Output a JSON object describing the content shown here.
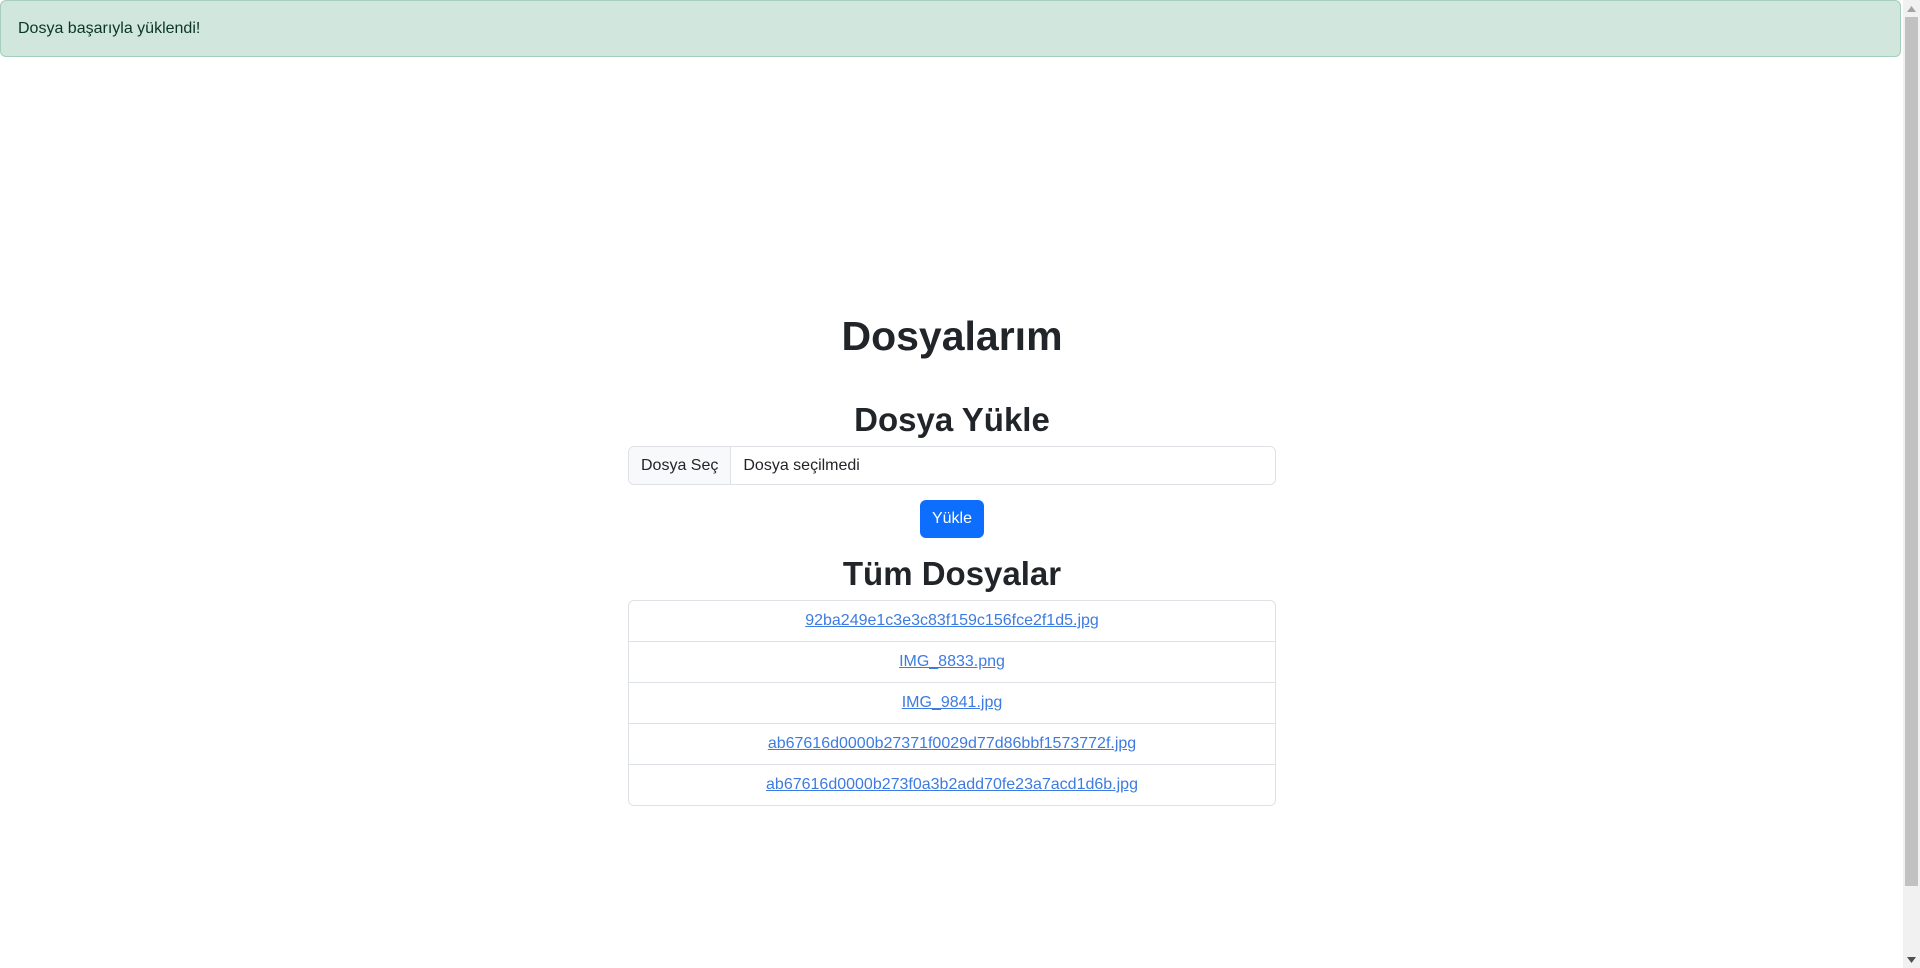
{
  "alert": {
    "message": "Dosya başarıyla yüklendi!"
  },
  "page": {
    "title": "Dosyalarım"
  },
  "upload": {
    "heading": "Dosya Yükle",
    "choose_label": "Dosya Seç",
    "status": "Dosya seçilmedi",
    "submit_label": "Yükle"
  },
  "files": {
    "heading": "Tüm Dosyalar",
    "items": [
      {
        "name": "92ba249e1c3e3c83f159c156fce2f1d5.jpg"
      },
      {
        "name": "IMG_8833.png"
      },
      {
        "name": "IMG_9841.jpg"
      },
      {
        "name": "ab67616d0000b27371f0029d77d86bbf1573772f.jpg"
      },
      {
        "name": "ab67616d0000b273f0a3b2add70fe23a7acd1d6b.jpg"
      }
    ]
  },
  "colors": {
    "alert_bg": "#d1e7dd",
    "alert_text": "#0a3622",
    "primary": "#0d6efd",
    "link": "#3d7be0"
  }
}
